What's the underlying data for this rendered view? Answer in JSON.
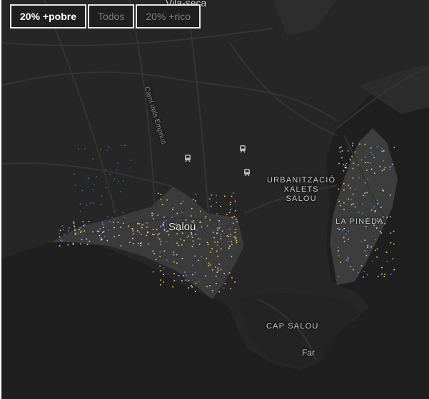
{
  "filters": {
    "buttons": [
      {
        "label": "20% +pobre",
        "active": true
      },
      {
        "label": "Todos",
        "active": false
      },
      {
        "label": "20% +rico",
        "active": false
      }
    ]
  },
  "map": {
    "place_labels": {
      "vila_seca": "Vila-seca",
      "salou": "Salou",
      "urbanitzacio": "URBANITZACIÓ\nXALETS\nSALOU",
      "la_pineda": "LA PINEDA",
      "cap_salou": "CAP SALOU",
      "far": "Far",
      "road_cami": "Camí dels Emprius"
    },
    "icons": [
      "train-station-icon",
      "train-station-icon",
      "train-station-icon"
    ],
    "colors": {
      "sea": "#1c1c1c",
      "land": "#262626",
      "urban": "#3a3a3a",
      "road": "#343434",
      "dot_yellow": "#e3d35a",
      "dot_blue": "#5b7fd6",
      "dot_white": "#d8d8d8"
    }
  }
}
